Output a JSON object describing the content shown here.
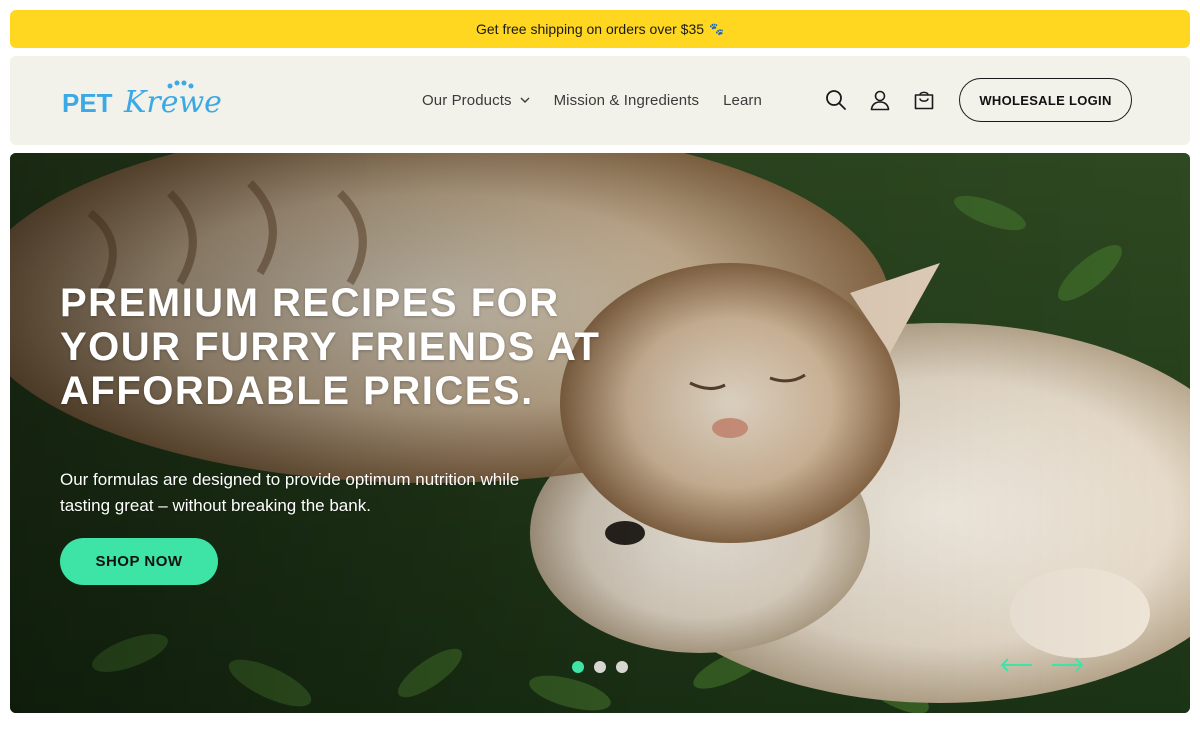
{
  "announcement": {
    "text": "Get free shipping on orders over $35",
    "icon": "paw-icon",
    "background": "#ffd620"
  },
  "header": {
    "logo": {
      "text_part1": "PET",
      "text_part2": "Krewe",
      "primary_color": "#3aa9e6"
    },
    "nav": [
      {
        "label": "Our Products",
        "has_dropdown": true
      },
      {
        "label": "Mission & Ingredients",
        "has_dropdown": false
      },
      {
        "label": "Learn",
        "has_dropdown": false
      }
    ],
    "icons": [
      "search-icon",
      "account-icon",
      "cart-icon"
    ],
    "wholesale_label": "WHOLESALE LOGIN",
    "background": "#f2f1ea"
  },
  "hero": {
    "title": "PREMIUM RECIPES FOR YOUR FURRY FRIENDS AT AFFORDABLE PRICES.",
    "subtitle": "Our formulas are designed to provide optimum nutrition while tasting great – without breaking the bank.",
    "cta_label": "SHOP NOW",
    "accent_color": "#3ee3a6",
    "slides_total": 3,
    "active_slide": 1
  }
}
